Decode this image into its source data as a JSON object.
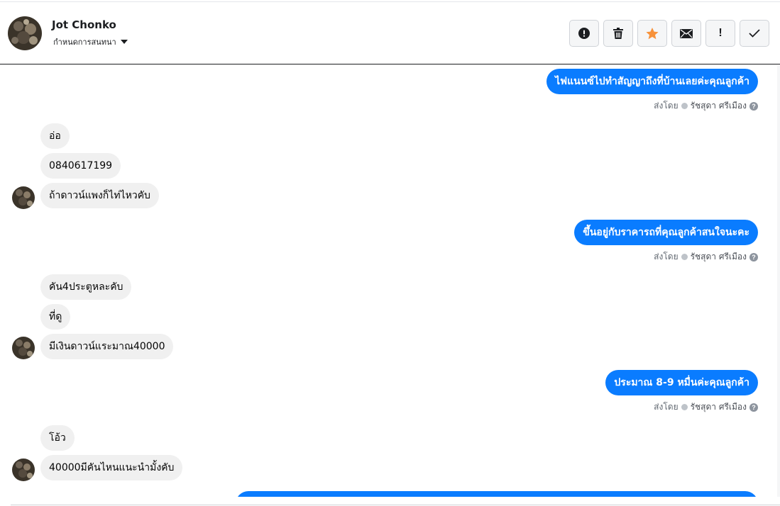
{
  "header": {
    "name": "Jot Chonko",
    "subtitle": "กำหนดการสนทนา"
  },
  "actions": [
    {
      "icon": "alert-circle-icon"
    },
    {
      "icon": "trash-icon"
    },
    {
      "icon": "star-icon",
      "color": "#f7923b"
    },
    {
      "icon": "envelope-icon"
    },
    {
      "icon": "exclamation-icon",
      "label": "!"
    },
    {
      "icon": "check-icon"
    }
  ],
  "sent_by": {
    "label": "ส่งโดย",
    "agent": "รัชสุดา ศรีเมือง",
    "help": "?"
  },
  "messages": {
    "out_1": "ไฟแนนซ์ไปทำสัญญาถึงที่บ้านเลยค่ะคุณลูกค้า",
    "in_1": "อ่อ",
    "in_2": "0840617199",
    "in_3": "ถ้าดาวน์แพงก็ไท่ไหวคับ",
    "out_2": "ขึ้นอยู่กับราคารถที่คุณลูกค้าสนใจนะคะ",
    "in_4": "คัน4ประตูหละคับ",
    "in_5": "ที่ดู",
    "in_6": "มีเงินดาวน์แระมาณ40000",
    "out_3": "ประมาณ 8-9 หมื่นค่ะคุณลูกค้า",
    "in_7": "โอ้ว",
    "in_8": "40000มีคันไหนแนะนำมั้งคับ"
  },
  "colors": {
    "outgoing_bubble": "#0a7cff",
    "incoming_bubble": "#f0f0f0",
    "star": "#f7923b"
  }
}
